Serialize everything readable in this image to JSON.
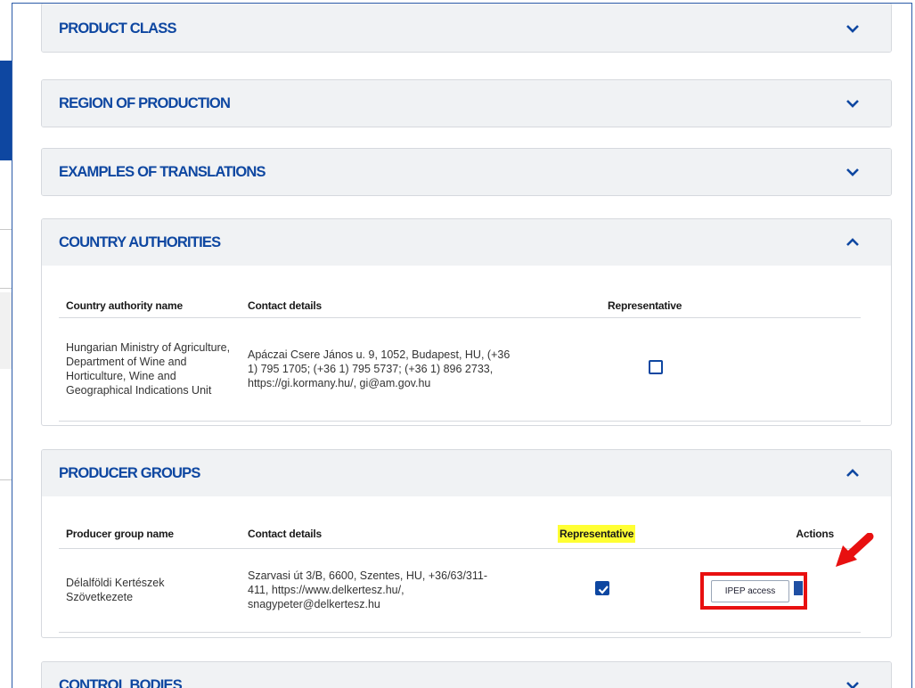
{
  "sections": {
    "product_class": "PRODUCT CLASS",
    "region_of_production": "REGION OF PRODUCTION",
    "examples_of_translations": "EXAMPLES OF TRANSLATIONS",
    "country_authorities": "COUNTRY AUTHORITIES",
    "producer_groups": "PRODUCER GROUPS",
    "control_bodies": "CONTROL BODIES"
  },
  "country_authorities": {
    "columns": [
      "Country authority name",
      "Contact details",
      "Representative"
    ],
    "rows": [
      {
        "name": "Hungarian Ministry of Agriculture, Department of Wine and Horticulture, Wine and Geographical Indications Unit",
        "contact": "Apáczai Csere János u. 9, 1052, Budapest, HU, (+36 1) 795 1705; (+36 1) 795 5737; (+36 1) 896 2733, https://gi.kormany.hu/, gi@am.gov.hu",
        "representative": false
      }
    ]
  },
  "producer_groups": {
    "columns": [
      "Producer group name",
      "Contact details",
      "Representative",
      "Actions"
    ],
    "rows": [
      {
        "name": "Délalföldi Kertészek Szövetkezete",
        "contact": "Szarvasi út 3/B, 6600, Szentes, HU, +36/63/311-411, https://www.delkertesz.hu/, snagypeter@delkertesz.hu",
        "representative": true,
        "action_label": "IPEP access"
      }
    ]
  },
  "colors": {
    "accent": "#0e47a1",
    "highlight": "#ffff33",
    "callout": "#e81010"
  }
}
